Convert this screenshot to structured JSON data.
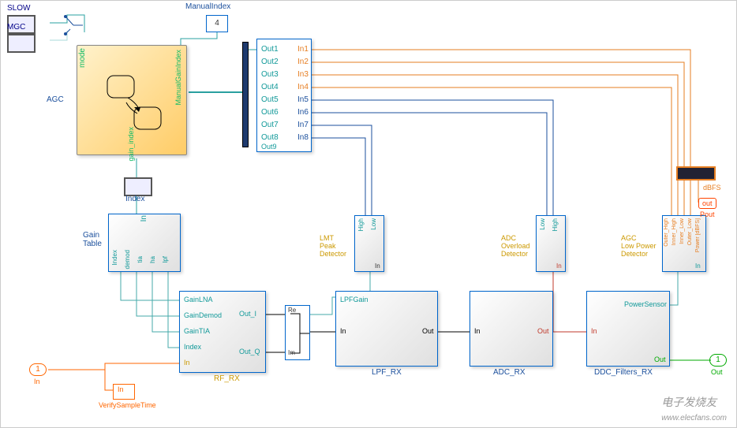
{
  "switches": {
    "slow": "SLOW",
    "mgc": "MGC"
  },
  "manual_index": {
    "label": "ManualIndex",
    "value": "4"
  },
  "agc": {
    "label": "AGC",
    "port_mode": "mode",
    "port_manual": "ManualGainIndex",
    "port_gain": "gain_index"
  },
  "index_scope": "Index",
  "gain_table": {
    "label": "Gain\nTable",
    "in": "In",
    "outs": [
      "Index",
      "demod",
      "tia",
      "ha",
      "lpf"
    ]
  },
  "bus_selector": {
    "outs": [
      "Out1",
      "Out2",
      "Out3",
      "Out4",
      "Out5",
      "Out6",
      "Out7",
      "Out8",
      "Out9"
    ],
    "ins": [
      "In1",
      "In2",
      "In3",
      "In4",
      "In5",
      "In6",
      "In7",
      "In8"
    ]
  },
  "rf_rx": {
    "label": "RF_RX",
    "in_gains": [
      "GainLNA",
      "GainDemod",
      "GainTIA",
      "Index"
    ],
    "in": "In",
    "out_i": "Out_I",
    "out_q": "Out_Q",
    "misc": "Re",
    "misc2": "Im"
  },
  "lpf_rx": {
    "label": "LPF_RX",
    "in": "In",
    "gain": "LPFGain",
    "out": "Out"
  },
  "adc_rx": {
    "label": "ADC_RX",
    "in": "In",
    "out": "Out"
  },
  "ddc": {
    "label": "DDC_Filters_RX",
    "in": "In",
    "out": "Out",
    "ps": "PowerSensor"
  },
  "lmt": {
    "label": "LMT\nPeak\nDetector",
    "hi": "High",
    "lo": "Low",
    "in": "In"
  },
  "adc_ov": {
    "label": "ADC\nOverload\nDetector",
    "hi": "High",
    "lo": "Low",
    "in": "In"
  },
  "agc_lp": {
    "label": "AGC\nLow Power\nDetector",
    "oh": "Outer_High",
    "ih": "Inner_High",
    "il": "Inner_Low",
    "ol": "Outer_Low",
    "pw": "Power [dBFS]",
    "in": "In"
  },
  "outputs": {
    "dbfs": "dBFS",
    "out": "out",
    "pout": "Pout",
    "out1": "1",
    "out1lbl": "Out"
  },
  "inport": {
    "num": "1",
    "lbl": "In"
  },
  "vst": {
    "label": "VerifySampleTime",
    "in": "In"
  },
  "watermark_logo": "电子发烧友",
  "watermark_url": "www.elecfans.com"
}
